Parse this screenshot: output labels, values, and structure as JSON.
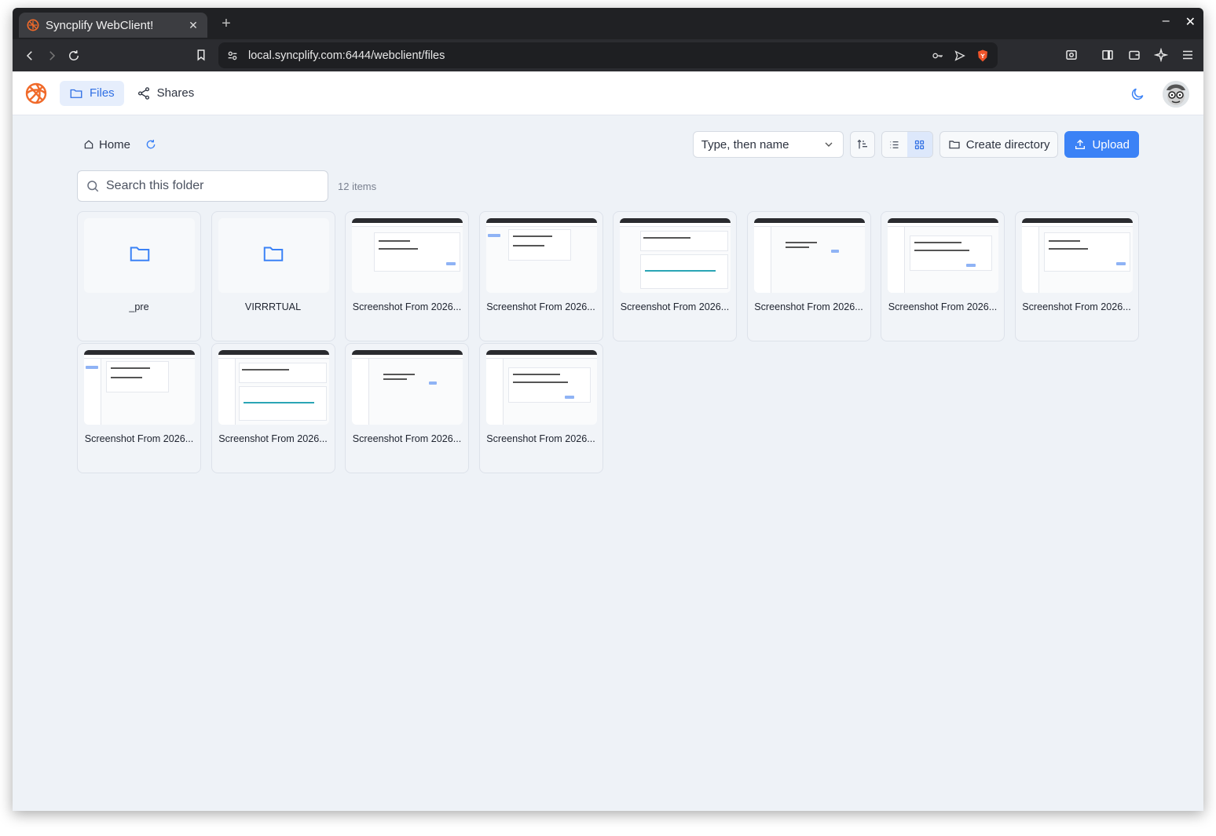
{
  "browser": {
    "tab_title": "Syncplify WebClient!",
    "tab_close": "✕",
    "new_tab": "+",
    "url": "local.syncplify.com:6444/webclient/files",
    "window_minimize": "–",
    "window_close": "✕"
  },
  "header": {
    "nav": [
      {
        "label": "Files",
        "active": true
      },
      {
        "label": "Shares",
        "active": false
      }
    ]
  },
  "toolbar": {
    "breadcrumb_home": "Home",
    "sort_select": "Type, then name",
    "create_directory": "Create directory",
    "upload": "Upload"
  },
  "search": {
    "placeholder": "Search this folder"
  },
  "item_count": "12 items",
  "files": [
    {
      "name": "_pre",
      "kind": "folder"
    },
    {
      "name": "VIRRRTUAL",
      "kind": "folder"
    },
    {
      "name": "Screenshot From 2026...",
      "kind": "image"
    },
    {
      "name": "Screenshot From 2026...",
      "kind": "image"
    },
    {
      "name": "Screenshot From 2026...",
      "kind": "image"
    },
    {
      "name": "Screenshot From 2026...",
      "kind": "image"
    },
    {
      "name": "Screenshot From 2026...",
      "kind": "image"
    },
    {
      "name": "Screenshot From 2026...",
      "kind": "image"
    },
    {
      "name": "Screenshot From 2026...",
      "kind": "image"
    },
    {
      "name": "Screenshot From 2026...",
      "kind": "image"
    },
    {
      "name": "Screenshot From 2026...",
      "kind": "image"
    },
    {
      "name": "Screenshot From 2026...",
      "kind": "image"
    }
  ],
  "colors": {
    "accent": "#3b82f6",
    "brand_orange": "#f06a2a"
  }
}
